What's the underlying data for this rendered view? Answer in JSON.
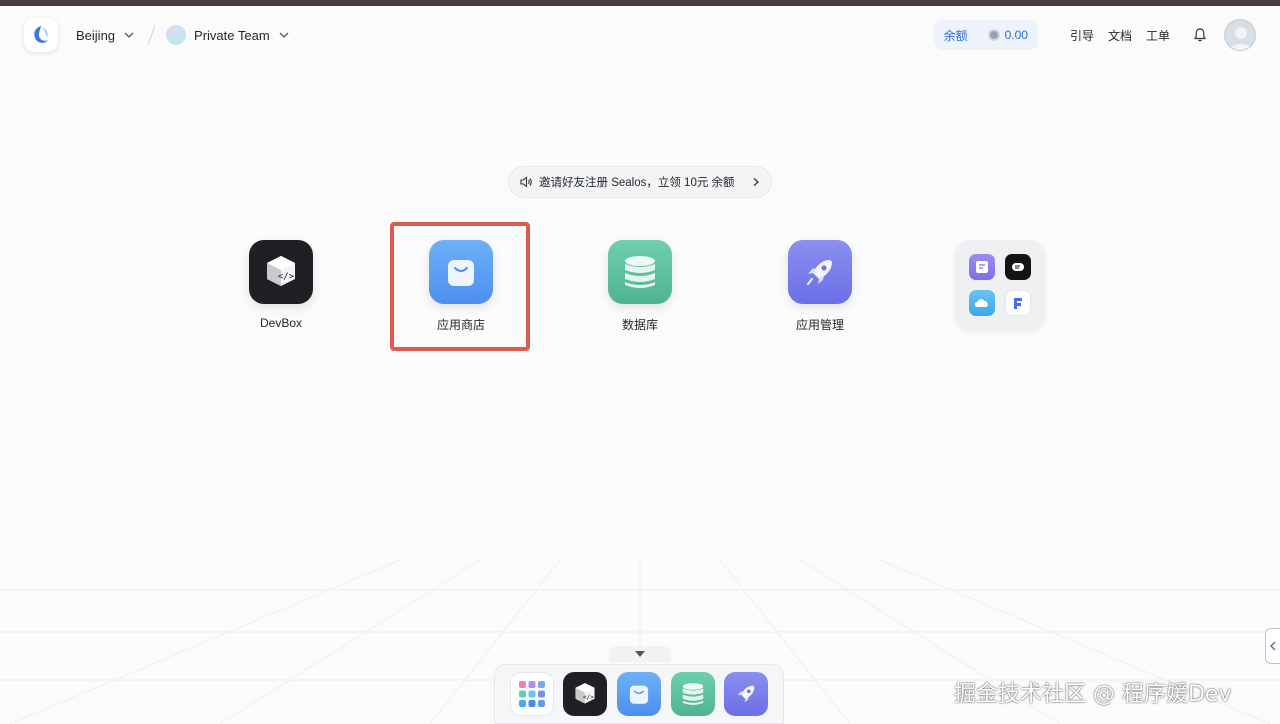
{
  "header": {
    "region": "Beijing",
    "team": "Private Team",
    "balance_label": "余额",
    "balance_value": "0.00",
    "links": [
      "引导",
      "文档",
      "工单"
    ]
  },
  "announcement": {
    "text": "邀请好友注册 Sealos，立领 10元 余额"
  },
  "apps": [
    {
      "label": "DevBox",
      "icon": "devbox-icon"
    },
    {
      "label": "应用商店",
      "icon": "app-store-icon"
    },
    {
      "label": "数据库",
      "icon": "database-icon"
    },
    {
      "label": "应用管理",
      "icon": "rocket-icon"
    }
  ],
  "folder_icons": [
    "form-icon",
    "terminal-icon",
    "cloud-icon",
    "f-icon"
  ],
  "dock_icons": [
    "app-grid-icon",
    "devbox-icon",
    "app-store-icon",
    "database-icon",
    "rocket-icon"
  ],
  "watermark": "掘金技术社区 @ 程序媛Dev",
  "colors": {
    "accent": "#2f6bd3",
    "highlight": "#e05a52",
    "app_store": "#5a9ff3",
    "database": "#5cc0a1",
    "rocket": "#7b80ec"
  }
}
